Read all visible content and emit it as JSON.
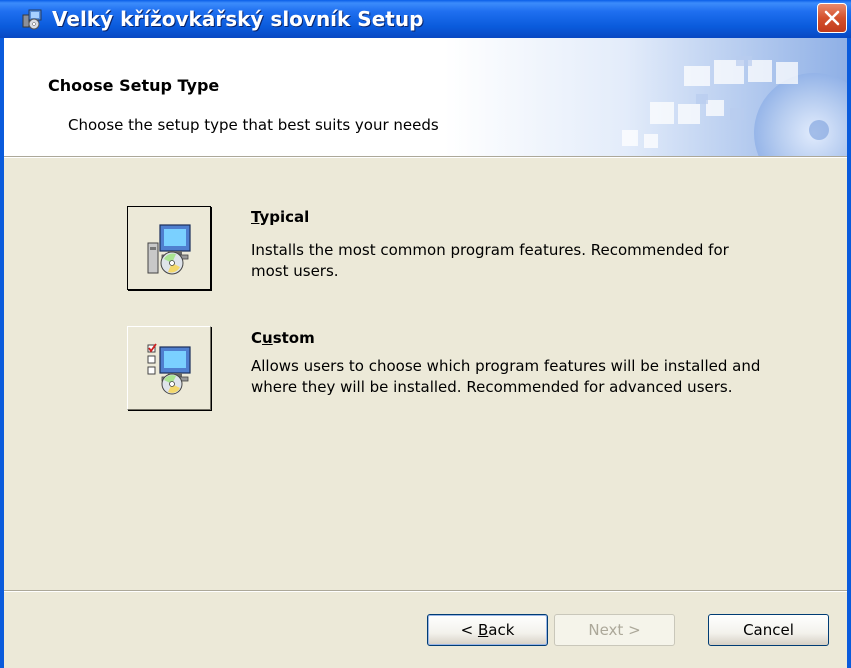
{
  "window": {
    "title": "Velký křížovkářský slovník Setup",
    "icon": "setup-installer-icon",
    "close_icon": "close-icon"
  },
  "header": {
    "title": "Choose Setup Type",
    "subtitle": "Choose the setup type that best suits your needs"
  },
  "options": [
    {
      "title_access": "T",
      "title_rest": "ypical",
      "description": "Installs the most common program features. Recommended for most users.",
      "icon": "typical-setup-icon"
    },
    {
      "title_access": "C",
      "title_rest2_prefix": "",
      "title_pre": "C",
      "title_u": "u",
      "title_post": "stom",
      "description": "Allows users to choose which program features will be installed and where they will be installed. Recommended for advanced users.",
      "icon": "custom-setup-icon"
    }
  ],
  "buttons": {
    "back_pre": "< ",
    "back_access": "B",
    "back_post": "ack",
    "next": "Next >",
    "cancel": "Cancel"
  },
  "colors": {
    "titlebar": "#0a5bdc",
    "dialog_bg": "#ece9d8",
    "close_button": "#d4512c"
  }
}
